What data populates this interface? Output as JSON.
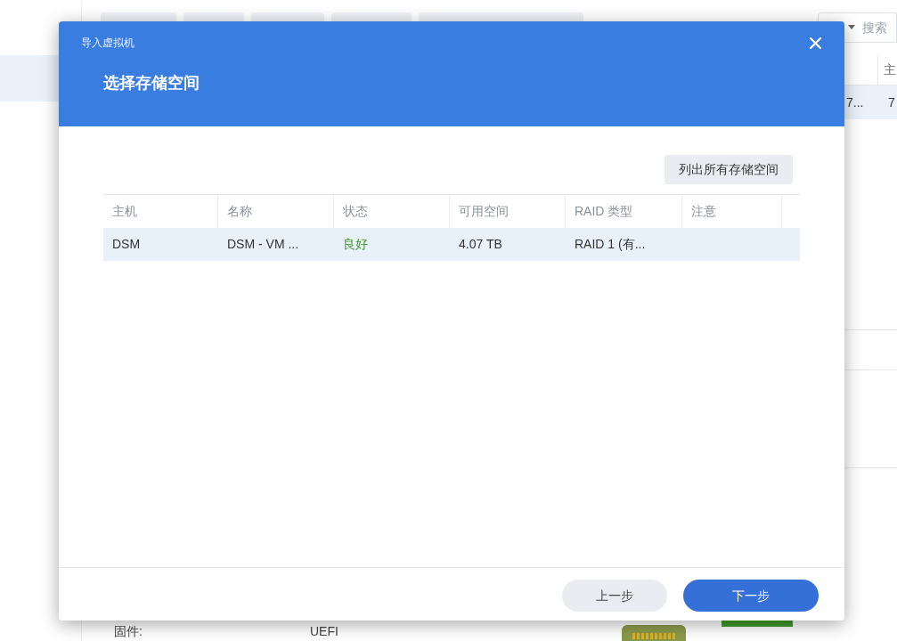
{
  "background": {
    "sidebar": {
      "items": [
        {
          "selected": true
        }
      ]
    },
    "search": {
      "placeholder": "搜索"
    },
    "table": {
      "columns": [
        "",
        "主"
      ],
      "rows": [
        {
          "selected": true,
          "cells": [
            "7...",
            "7"
          ]
        }
      ]
    },
    "details": [
      {
        "label": "固件:",
        "value": "UEFI"
      }
    ]
  },
  "dialog": {
    "window_title": "导入虚拟机",
    "heading": "选择存储空间",
    "list_all_button": "列出所有存储空间",
    "table": {
      "columns": [
        "主机",
        "名称",
        "状态",
        "可用空间",
        "RAID 类型",
        "注意"
      ],
      "rows": [
        {
          "selected": true,
          "host": "DSM",
          "name": "DSM - VM ...",
          "status": {
            "text": "良好",
            "kind": "good"
          },
          "free_space": "4.07 TB",
          "raid_type": "RAID 1 (有...",
          "note": ""
        }
      ]
    },
    "buttons": [
      {
        "label": "上一步",
        "kind": "secondary"
      },
      {
        "label": "下一步",
        "kind": "primary"
      }
    ]
  }
}
